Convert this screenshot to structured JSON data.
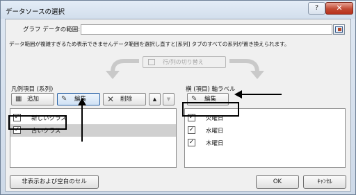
{
  "window": {
    "title": "データソースの選択",
    "help_glyph": "?",
    "close_glyph": "✕"
  },
  "range": {
    "label": "グラフ データの範囲:",
    "value": ""
  },
  "info_text": "データ範囲が複雑すぎるため表示できませんデータ範囲を選択し直すと[系列] タブのすべての系列が置き換えられます。",
  "switch_button": {
    "label": "行/列の切り替え"
  },
  "legend": {
    "title": "凡例項目 (系列)",
    "add_label": "追加",
    "edit_label": "編集",
    "delete_label": "削除",
    "up_glyph": "▲",
    "down_glyph": "▼",
    "items": [
      {
        "label": "新しいクラス",
        "checked": true,
        "check_glyph": "✓"
      },
      {
        "label": "古いクラス",
        "checked": true,
        "check_glyph": "✓"
      }
    ]
  },
  "axis": {
    "title": "横 (項目) 軸ラベル",
    "edit_label": "編集",
    "items": [
      {
        "label": "火曜日",
        "checked": true,
        "check_glyph": "✓"
      },
      {
        "label": "水曜日",
        "checked": true,
        "check_glyph": "✓"
      },
      {
        "label": "木曜日",
        "checked": true,
        "check_glyph": "✓"
      }
    ]
  },
  "footer": {
    "hidden_cells_label": "非表示および空白のセル",
    "ok_label": "OK",
    "cancel_label": "ｷｬﾝｾﾙ"
  },
  "colors": {
    "title_bar": "#d6e1ee",
    "close_button": "#c24a33",
    "edit_highlight": "#2f66a7"
  }
}
